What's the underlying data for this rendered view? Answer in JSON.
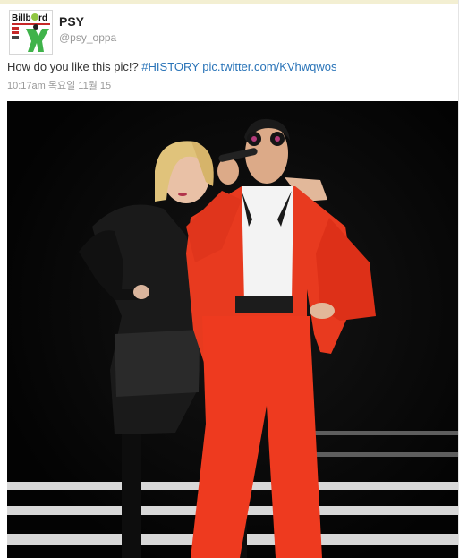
{
  "tweet": {
    "author_name": "PSY",
    "author_handle": "@psy_oppa",
    "text_plain": "How do you like this pic!? ",
    "hashtag": "#HISTORY",
    "link": "pic.twitter.com/KVhwqwos",
    "timestamp": "10:17am 목요일 11월 15"
  },
  "avatar": {
    "brand": "Billboard"
  },
  "photo": {
    "description_icon": "concert-photo",
    "colors": {
      "suit": "#e83a1f",
      "background": "#050505",
      "stage_stripes": "#d8d8d8"
    }
  }
}
